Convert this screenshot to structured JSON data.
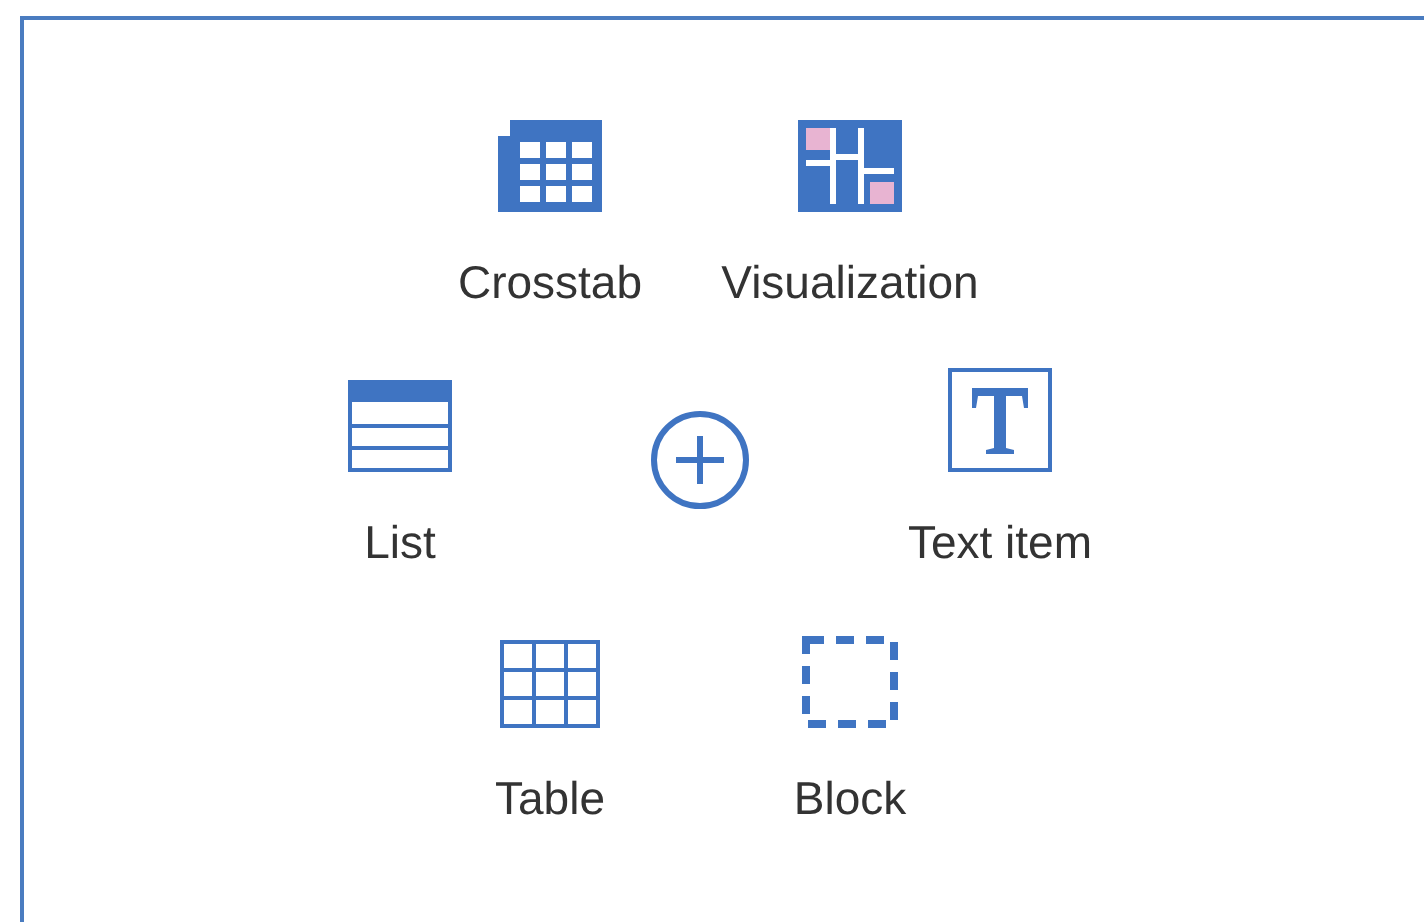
{
  "rows": [
    [
      {
        "kind": "crosstab",
        "label": "Crosstab"
      },
      {
        "kind": "visualization",
        "label": "Visualization"
      }
    ],
    [
      {
        "kind": "list",
        "label": "List"
      },
      {
        "kind": "add"
      },
      {
        "kind": "text",
        "label": "Text item"
      }
    ],
    [
      {
        "kind": "table",
        "label": "Table"
      },
      {
        "kind": "block",
        "label": "Block"
      }
    ]
  ]
}
